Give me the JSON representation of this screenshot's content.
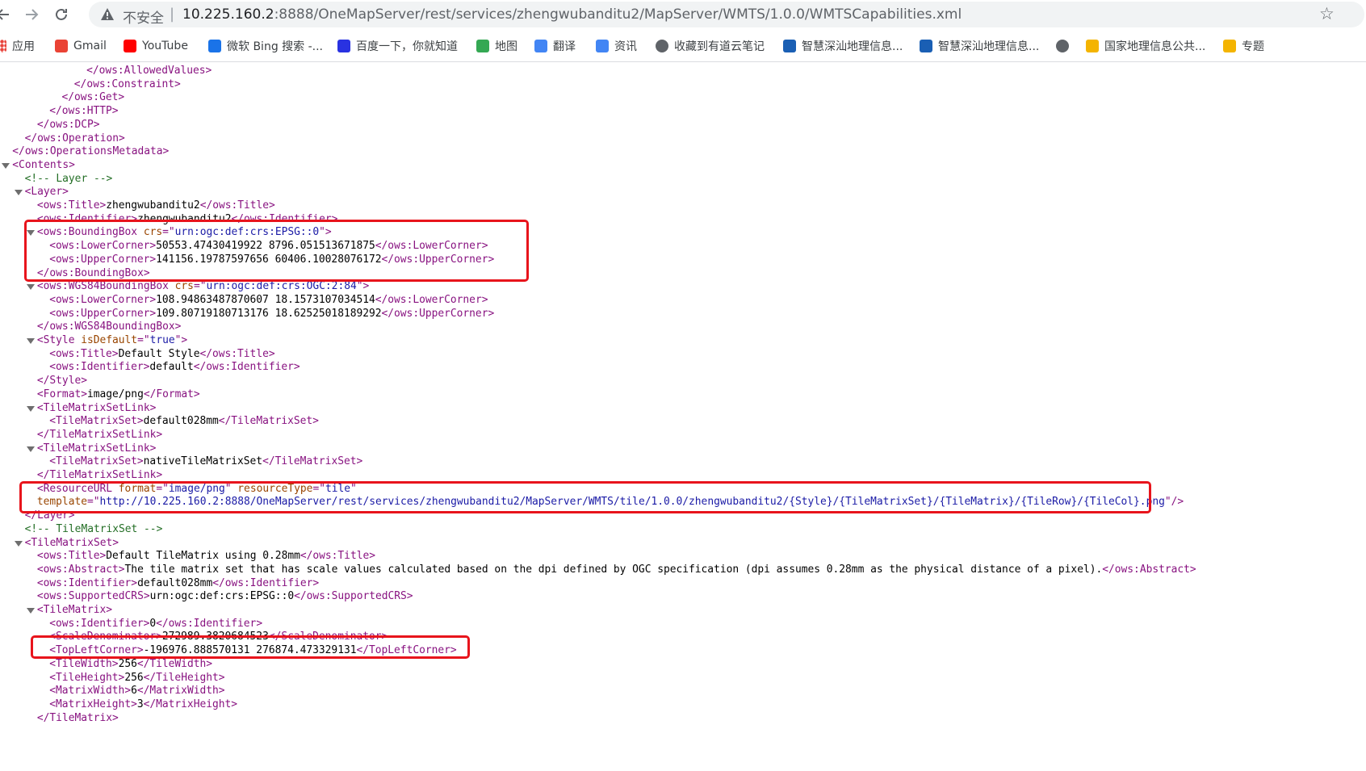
{
  "browser": {
    "back_icon": "arrow-left-icon",
    "forward_icon": "arrow-right-icon",
    "reload_icon": "reload-icon",
    "security_label": "不安全",
    "separator": "|",
    "url_host": "10.225.160.2",
    "url_rest": ":8888/OneMapServer/rest/services/zhengwubanditu2/MapServer/WMTS/1.0.0/WMTSCapabilities.xml",
    "star_icon": "bookmark-star-icon"
  },
  "bookmarks": [
    {
      "label": "应用",
      "icon": "apps-grid-icon",
      "color": "#e8453c"
    },
    {
      "label": "Gmail",
      "icon": "gmail-icon",
      "color": "#ea4335"
    },
    {
      "label": "YouTube",
      "icon": "youtube-icon",
      "color": "#ff0000"
    },
    {
      "label": "微软 Bing 搜索 -...",
      "icon": "bing-icon",
      "color": "#1a73e8"
    },
    {
      "label": "百度一下，你就知道",
      "icon": "baidu-icon",
      "color": "#2932e1"
    },
    {
      "label": "地图",
      "icon": "maps-icon",
      "color": "#34a853"
    },
    {
      "label": "翻译",
      "icon": "translate-icon",
      "color": "#4285f4"
    },
    {
      "label": "资讯",
      "icon": "news-icon",
      "color": "#4285f4"
    },
    {
      "label": "收藏到有道云笔记",
      "icon": "globe-icon",
      "color": "#5f6368"
    },
    {
      "label": "智慧深汕地理信息...",
      "icon": "site-icon",
      "color": "#1a5fb4"
    },
    {
      "label": "智慧深汕地理信息...",
      "icon": "site-icon",
      "color": "#1a5fb4"
    },
    {
      "label": "",
      "icon": "globe-icon",
      "color": "#5f6368"
    },
    {
      "label": "国家地理信息公共...",
      "icon": "tianditu-icon",
      "color": "#f4b400"
    },
    {
      "label": "专题",
      "icon": "tianditu-icon",
      "color": "#f4b400"
    }
  ],
  "xml_lines": [
    {
      "indent": 7,
      "parts": [
        [
          "tg",
          "</ows:AllowedValues>"
        ]
      ]
    },
    {
      "indent": 6,
      "parts": [
        [
          "tg",
          "</ows:Constraint>"
        ]
      ]
    },
    {
      "indent": 5,
      "parts": [
        [
          "tg",
          "</ows:Get>"
        ]
      ]
    },
    {
      "indent": 4,
      "parts": [
        [
          "tg",
          "</ows:HTTP>"
        ]
      ]
    },
    {
      "indent": 3,
      "parts": [
        [
          "tg",
          "</ows:DCP>"
        ]
      ]
    },
    {
      "indent": 2,
      "parts": [
        [
          "tg",
          "</ows:Operation>"
        ]
      ]
    },
    {
      "indent": 1,
      "parts": [
        [
          "tg",
          "</ows:OperationsMetadata>"
        ]
      ]
    },
    {
      "indent": 1,
      "toggle": true,
      "parts": [
        [
          "tg",
          "<Contents>"
        ]
      ]
    },
    {
      "indent": 2,
      "parts": [
        [
          "cm",
          "<!-- Layer -->"
        ]
      ]
    },
    {
      "indent": 2,
      "toggle": true,
      "parts": [
        [
          "tg",
          "<Layer>"
        ]
      ]
    },
    {
      "indent": 3,
      "parts": [
        [
          "tg",
          "<ows:Title>"
        ],
        [
          "tx",
          "zhengwubanditu2"
        ],
        [
          "tg",
          "</ows:Title>"
        ]
      ]
    },
    {
      "indent": 3,
      "parts": [
        [
          "tg",
          "<ows:Identifier>"
        ],
        [
          "tx",
          "zhengwubanditu2"
        ],
        [
          "tg",
          "</ows:Identifier>"
        ]
      ]
    },
    {
      "indent": 3,
      "toggle": true,
      "parts": [
        [
          "tg",
          "<ows:BoundingBox "
        ],
        [
          "an",
          "crs"
        ],
        [
          "tg",
          "=\""
        ],
        [
          "av",
          "urn:ogc:def:crs:EPSG::0"
        ],
        [
          "tg",
          "\">"
        ]
      ]
    },
    {
      "indent": 4,
      "parts": [
        [
          "tg",
          "<ows:LowerCorner>"
        ],
        [
          "tx",
          "50553.47430419922 8796.051513671875"
        ],
        [
          "tg",
          "</ows:LowerCorner>"
        ]
      ]
    },
    {
      "indent": 4,
      "parts": [
        [
          "tg",
          "<ows:UpperCorner>"
        ],
        [
          "tx",
          "141156.19787597656 60406.10028076172"
        ],
        [
          "tg",
          "</ows:UpperCorner>"
        ]
      ]
    },
    {
      "indent": 3,
      "parts": [
        [
          "tg",
          "</ows:BoundingBox>"
        ]
      ]
    },
    {
      "indent": 3,
      "toggle": true,
      "parts": [
        [
          "tg",
          "<ows:WGS84BoundingBox "
        ],
        [
          "an",
          "crs"
        ],
        [
          "tg",
          "=\""
        ],
        [
          "av",
          "urn:ogc:def:crs:OGC:2:84"
        ],
        [
          "tg",
          "\">"
        ]
      ]
    },
    {
      "indent": 4,
      "parts": [
        [
          "tg",
          "<ows:LowerCorner>"
        ],
        [
          "tx",
          "108.94863487870607 18.1573107034514"
        ],
        [
          "tg",
          "</ows:LowerCorner>"
        ]
      ]
    },
    {
      "indent": 4,
      "parts": [
        [
          "tg",
          "<ows:UpperCorner>"
        ],
        [
          "tx",
          "109.80719180713176 18.62525018189292"
        ],
        [
          "tg",
          "</ows:UpperCorner>"
        ]
      ]
    },
    {
      "indent": 3,
      "parts": [
        [
          "tg",
          "</ows:WGS84BoundingBox>"
        ]
      ]
    },
    {
      "indent": 3,
      "toggle": true,
      "parts": [
        [
          "tg",
          "<Style "
        ],
        [
          "an",
          "isDefault"
        ],
        [
          "tg",
          "=\""
        ],
        [
          "av",
          "true"
        ],
        [
          "tg",
          "\">"
        ]
      ]
    },
    {
      "indent": 4,
      "parts": [
        [
          "tg",
          "<ows:Title>"
        ],
        [
          "tx",
          "Default Style"
        ],
        [
          "tg",
          "</ows:Title>"
        ]
      ]
    },
    {
      "indent": 4,
      "parts": [
        [
          "tg",
          "<ows:Identifier>"
        ],
        [
          "tx",
          "default"
        ],
        [
          "tg",
          "</ows:Identifier>"
        ]
      ]
    },
    {
      "indent": 3,
      "parts": [
        [
          "tg",
          "</Style>"
        ]
      ]
    },
    {
      "indent": 3,
      "parts": [
        [
          "tg",
          "<Format>"
        ],
        [
          "tx",
          "image/png"
        ],
        [
          "tg",
          "</Format>"
        ]
      ]
    },
    {
      "indent": 3,
      "toggle": true,
      "parts": [
        [
          "tg",
          "<TileMatrixSetLink>"
        ]
      ]
    },
    {
      "indent": 4,
      "parts": [
        [
          "tg",
          "<TileMatrixSet>"
        ],
        [
          "tx",
          "default028mm"
        ],
        [
          "tg",
          "</TileMatrixSet>"
        ]
      ]
    },
    {
      "indent": 3,
      "parts": [
        [
          "tg",
          "</TileMatrixSetLink>"
        ]
      ]
    },
    {
      "indent": 3,
      "toggle": true,
      "parts": [
        [
          "tg",
          "<TileMatrixSetLink>"
        ]
      ]
    },
    {
      "indent": 4,
      "parts": [
        [
          "tg",
          "<TileMatrixSet>"
        ],
        [
          "tx",
          "nativeTileMatrixSet"
        ],
        [
          "tg",
          "</TileMatrixSet>"
        ]
      ]
    },
    {
      "indent": 3,
      "parts": [
        [
          "tg",
          "</TileMatrixSetLink>"
        ]
      ]
    },
    {
      "indent": 3,
      "parts": [
        [
          "tg",
          "<ResourceURL "
        ],
        [
          "an",
          "format"
        ],
        [
          "tg",
          "=\""
        ],
        [
          "av",
          "image/png"
        ],
        [
          "tg",
          "\" "
        ],
        [
          "an",
          "resourceType"
        ],
        [
          "tg",
          "=\""
        ],
        [
          "av",
          "tile"
        ],
        [
          "tg",
          "\""
        ]
      ]
    },
    {
      "indent": 3,
      "parts": [
        [
          "an",
          "template"
        ],
        [
          "tg",
          "=\""
        ],
        [
          "av",
          "http://10.225.160.2:8888/OneMapServer/rest/services/zhengwubanditu2/MapServer/WMTS/tile/1.0.0/zhengwubanditu2/{Style}/{TileMatrixSet}/{TileMatrix}/{TileRow}/{TileCol}.png"
        ],
        [
          "tg",
          "\"/>"
        ]
      ]
    },
    {
      "indent": 2,
      "parts": [
        [
          "tg",
          "</Layer>"
        ]
      ]
    },
    {
      "indent": 2,
      "parts": [
        [
          "cm",
          "<!-- TileMatrixSet -->"
        ]
      ]
    },
    {
      "indent": 2,
      "toggle": true,
      "parts": [
        [
          "tg",
          "<TileMatrixSet>"
        ]
      ]
    },
    {
      "indent": 3,
      "parts": [
        [
          "tg",
          "<ows:Title>"
        ],
        [
          "tx",
          "Default TileMatrix using 0.28mm"
        ],
        [
          "tg",
          "</ows:Title>"
        ]
      ]
    },
    {
      "indent": 3,
      "parts": [
        [
          "tg",
          "<ows:Abstract>"
        ],
        [
          "tx",
          "The tile matrix set that has scale values calculated based on the dpi defined by OGC specification (dpi assumes 0.28mm as the physical distance of a pixel)."
        ],
        [
          "tg",
          "</ows:Abstract>"
        ]
      ]
    },
    {
      "indent": 3,
      "parts": [
        [
          "tg",
          "<ows:Identifier>"
        ],
        [
          "tx",
          "default028mm"
        ],
        [
          "tg",
          "</ows:Identifier>"
        ]
      ]
    },
    {
      "indent": 3,
      "parts": [
        [
          "tg",
          "<ows:SupportedCRS>"
        ],
        [
          "tx",
          "urn:ogc:def:crs:EPSG::0"
        ],
        [
          "tg",
          "</ows:SupportedCRS>"
        ]
      ]
    },
    {
      "indent": 3,
      "toggle": true,
      "parts": [
        [
          "tg",
          "<TileMatrix>"
        ]
      ]
    },
    {
      "indent": 4,
      "parts": [
        [
          "tg",
          "<ows:Identifier>"
        ],
        [
          "tx",
          "0"
        ],
        [
          "tg",
          "</ows:Identifier>"
        ]
      ]
    },
    {
      "indent": 4,
      "parts": [
        [
          "tg",
          "<ScaleDenominator>"
        ],
        [
          "tx",
          "272989.3820684523"
        ],
        [
          "tg",
          "</ScaleDenominator>"
        ]
      ]
    },
    {
      "indent": 4,
      "parts": [
        [
          "tg",
          "<TopLeftCorner>"
        ],
        [
          "tx",
          "-196976.888570131 276874.473329131"
        ],
        [
          "tg",
          "</TopLeftCorner>"
        ]
      ]
    },
    {
      "indent": 4,
      "parts": [
        [
          "tg",
          "<TileWidth>"
        ],
        [
          "tx",
          "256"
        ],
        [
          "tg",
          "</TileWidth>"
        ]
      ]
    },
    {
      "indent": 4,
      "parts": [
        [
          "tg",
          "<TileHeight>"
        ],
        [
          "tx",
          "256"
        ],
        [
          "tg",
          "</TileHeight>"
        ]
      ]
    },
    {
      "indent": 4,
      "parts": [
        [
          "tg",
          "<MatrixWidth>"
        ],
        [
          "tx",
          "6"
        ],
        [
          "tg",
          "</MatrixWidth>"
        ]
      ]
    },
    {
      "indent": 4,
      "parts": [
        [
          "tg",
          "<MatrixHeight>"
        ],
        [
          "tx",
          "3"
        ],
        [
          "tg",
          "</MatrixHeight>"
        ]
      ]
    },
    {
      "indent": 3,
      "parts": [
        [
          "tg",
          "</TileMatrix>"
        ]
      ]
    }
  ]
}
